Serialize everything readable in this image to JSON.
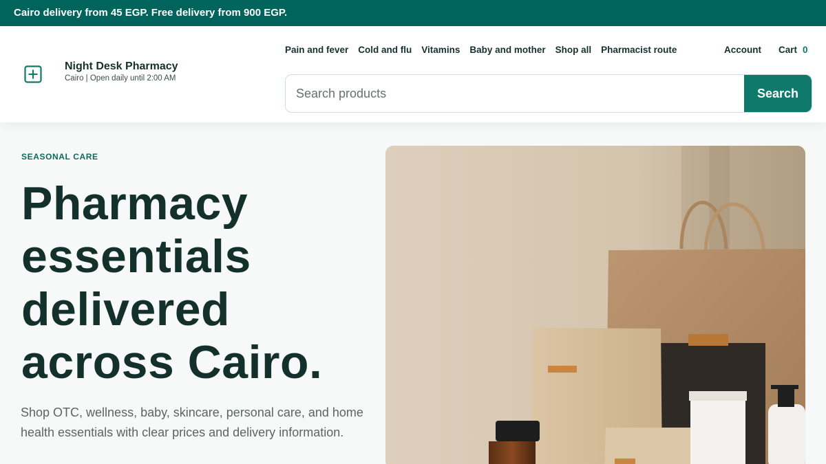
{
  "promo": {
    "text": "Cairo delivery from 45 EGP. Free delivery from 900 EGP."
  },
  "brand": {
    "name": "Night Desk Pharmacy",
    "subtitle": "Cairo | Open daily until 2:00 AM",
    "icon": "plus-box-icon"
  },
  "nav": {
    "items": [
      {
        "label": "Pain and fever"
      },
      {
        "label": "Cold and flu"
      },
      {
        "label": "Vitamins"
      },
      {
        "label": "Baby and mother"
      },
      {
        "label": "Shop all"
      },
      {
        "label": "Pharmacist route"
      }
    ],
    "account_label": "Account",
    "cart_label": "Cart",
    "cart_count": "0"
  },
  "search": {
    "placeholder": "Search products",
    "button_label": "Search"
  },
  "hero": {
    "eyebrow": "SEASONAL CARE",
    "headline": "Pharmacy essentials delivered across Cairo.",
    "lede": "Shop OTC, wellness, baby, skincare, personal care, and home health essentials with clear prices and delivery information."
  },
  "colors": {
    "accent": "#0f7a6c",
    "promo_bg": "#00645c",
    "heading": "#14302a"
  }
}
